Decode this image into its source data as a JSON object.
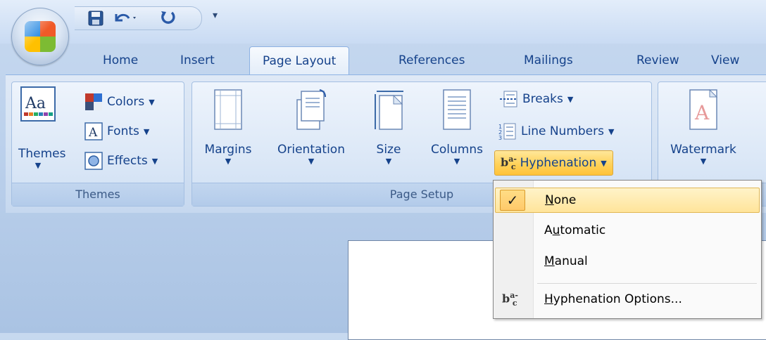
{
  "tabs": [
    "Home",
    "Insert",
    "Page Layout",
    "References",
    "Mailings",
    "Review",
    "View"
  ],
  "active_tab": "Page Layout",
  "groups": {
    "themes": {
      "label": "Themes",
      "themes_button": "Themes",
      "colors": "Colors",
      "fonts": "Fonts",
      "effects": "Effects"
    },
    "page_setup": {
      "label": "Page Setup",
      "margins": "Margins",
      "orientation": "Orientation",
      "size": "Size",
      "columns": "Columns",
      "breaks": "Breaks",
      "line_numbers": "Line Numbers",
      "hyphenation": "Hyphenation"
    },
    "page_background": {
      "watermark": "Watermark"
    }
  },
  "hyphenation_menu": {
    "items": [
      {
        "pre": "",
        "ul": "N",
        "post": "one",
        "checked": true
      },
      {
        "pre": "A",
        "ul": "u",
        "post": "tomatic",
        "checked": false
      },
      {
        "pre": "",
        "ul": "M",
        "post": "anual",
        "checked": false
      },
      {
        "pre": "",
        "ul": "H",
        "post": "yphenation Options...",
        "checked": false
      }
    ],
    "check_mark": "✓"
  },
  "icons": {
    "office_button": "office-logo-icon",
    "save": "save-icon",
    "undo": "undo-icon",
    "redo": "redo-icon",
    "hyphenation": "hyphenation-icon"
  },
  "colors": {
    "accent_text": "#15428b",
    "highlight": "#ffd25a",
    "ribbon_border": "#8db2e3"
  }
}
